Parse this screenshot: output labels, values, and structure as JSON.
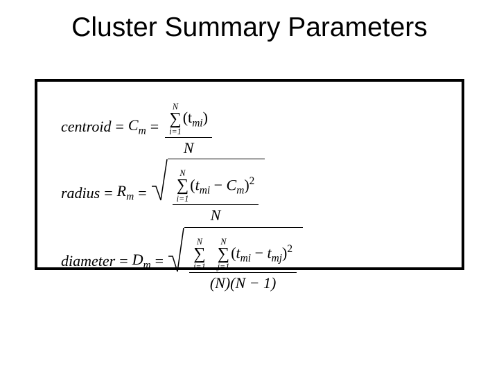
{
  "slide": {
    "title": "Cluster Summary Parameters"
  },
  "equations": {
    "centroid": {
      "name": "centroid",
      "symbol_letter": "C",
      "symbol_sub": "m",
      "frac": {
        "num_sum": {
          "upper": "N",
          "lower": "i=1",
          "term": "(t",
          "term_sub": "mi",
          "term_close": ")"
        },
        "den": "N"
      }
    },
    "radius": {
      "name": "radius",
      "symbol_letter": "R",
      "symbol_sub": "m",
      "frac": {
        "num_sum": {
          "upper": "N",
          "lower": "i=1",
          "open": "(",
          "a_letter": "t",
          "a_sub": "mi",
          "minus": " − ",
          "b_letter": "C",
          "b_sub": "m",
          "close": ")",
          "power": "2"
        },
        "den": "N"
      }
    },
    "diameter": {
      "name": "diameter",
      "symbol_letter": "D",
      "symbol_sub": "m",
      "frac": {
        "num_sum_outer": {
          "upper": "N",
          "lower": "i=1"
        },
        "num_sum_inner": {
          "upper": "N",
          "lower": "j=1",
          "open": "(",
          "a_letter": "t",
          "a_sub": "mi",
          "minus": " − ",
          "b_letter": "t",
          "b_sub": "mj",
          "close": ")",
          "power": "2"
        },
        "den": "(N)(N − 1)"
      }
    }
  },
  "symbols": {
    "sigma": "∑",
    "equals": "="
  }
}
